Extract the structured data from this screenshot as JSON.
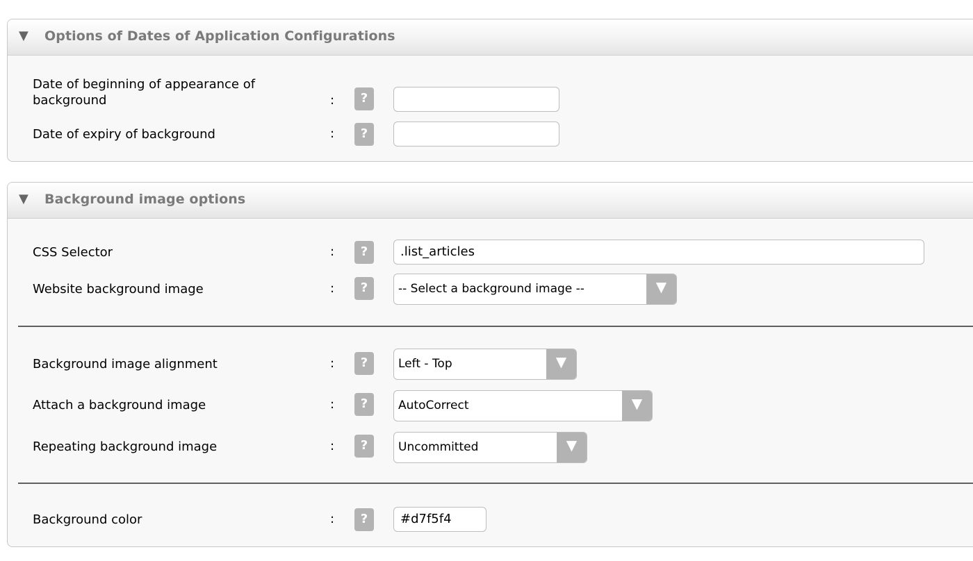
{
  "dates_panel": {
    "toggle_icon": "▼",
    "title": "Options of Dates of Application Configurations",
    "fields": [
      {
        "label_line1": "Date of beginning of appearance of",
        "label_line2": "background",
        "colon": ":",
        "help": "?",
        "value": ""
      },
      {
        "label": "Date of expiry of background",
        "colon": ":",
        "help": "?",
        "value": ""
      }
    ]
  },
  "background_panel": {
    "toggle_icon": "▼",
    "title": "Background image options",
    "css_selector": {
      "label": "CSS Selector",
      "colon": ":",
      "help": "?",
      "value": ".list_articles"
    },
    "bg_image": {
      "label": "Website background image",
      "colon": ":",
      "help": "?",
      "value": "-- Select a background image --",
      "arrow": "▼"
    },
    "alignment": {
      "label": "Background image alignment",
      "colon": ":",
      "help": "?",
      "value": "Left - Top",
      "arrow": "▼"
    },
    "attach": {
      "label": "Attach a background image",
      "colon": ":",
      "help": "?",
      "value": "AutoCorrect",
      "arrow": "▼"
    },
    "repeat": {
      "label": "Repeating background image",
      "colon": ":",
      "help": "?",
      "value": "Uncommitted",
      "arrow": "▼"
    },
    "color": {
      "label": "Background color",
      "colon": ":",
      "help": "?",
      "value": "#d7f5f4"
    }
  }
}
